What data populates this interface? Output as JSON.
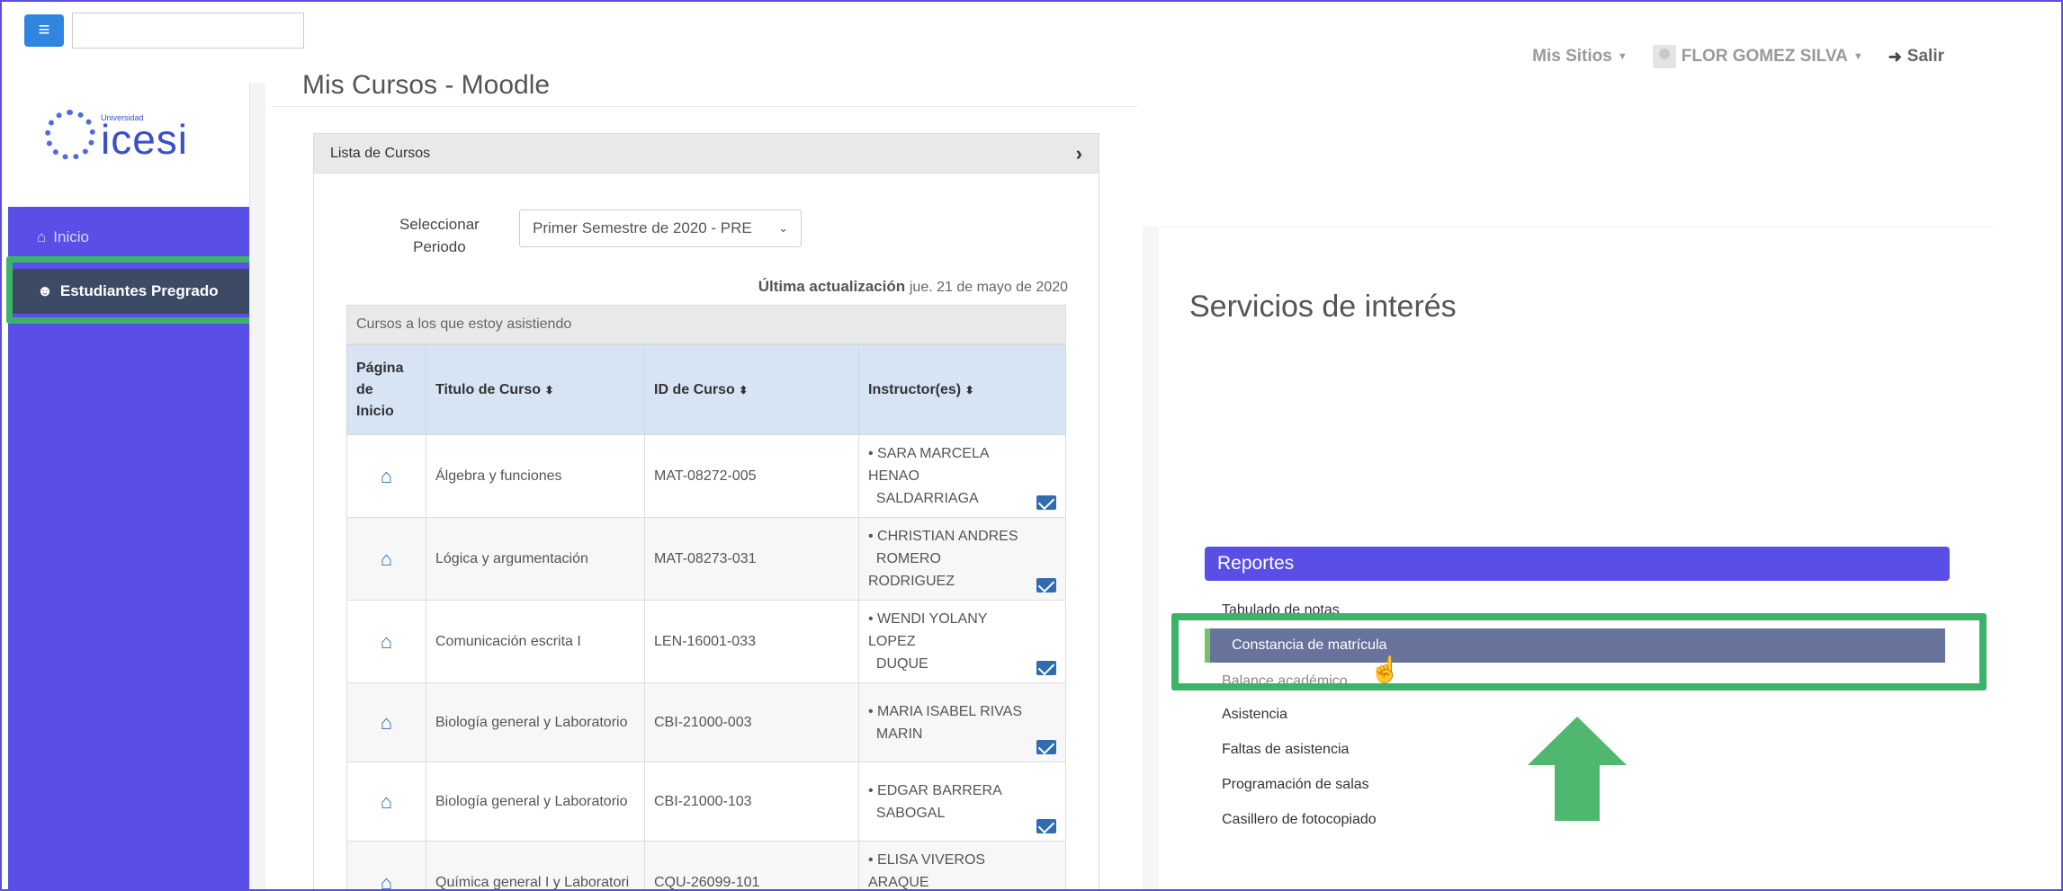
{
  "topbar": {
    "menu_icon": "hamburger-icon",
    "search_value": "",
    "sites_label": "Mis Sitios",
    "user_name": "FLOR GOMEZ SILVA",
    "logout_label": "Salir"
  },
  "logo": {
    "small": "Universidad",
    "big": "icesi"
  },
  "sidebar": {
    "items": [
      {
        "label": "Inicio",
        "icon": "home-icon"
      },
      {
        "label": "Estudiantes Pregrado",
        "icon": "student-icon"
      }
    ]
  },
  "main": {
    "title": "Mis Cursos - Moodle",
    "panel_title": "Lista de Cursos",
    "period_label_1": "Seleccionar",
    "period_label_2": "Periodo",
    "period_value": "Primer Semestre de 2020 - PRE",
    "updated_label": "Última actualización",
    "updated_value": "jue. 21 de mayo de 2020",
    "table_caption": "Cursos a los que estoy asistiendo",
    "columns": [
      "Página de Inicio",
      "Titulo de Curso",
      "ID de Curso",
      "Instructor(es)"
    ],
    "column_home_lines": [
      "Página",
      "de",
      "Inicio"
    ],
    "rows": [
      {
        "title": "Álgebra y funciones",
        "id": "MAT-08272-005",
        "instructor_1": "SARA MARCELA HENAO",
        "instructor_2": "SALDARRIAGA"
      },
      {
        "title": "Lógica y argumentación",
        "id": "MAT-08273-031",
        "instructor_1": "CHRISTIAN ANDRES",
        "instructor_2": "ROMERO RODRIGUEZ"
      },
      {
        "title": "Comunicación escrita I",
        "id": "LEN-16001-033",
        "instructor_1": "WENDI YOLANY LOPEZ",
        "instructor_2": "DUQUE"
      },
      {
        "title": "Biología general y Laboratorio",
        "id": "CBI-21000-003",
        "instructor_1": "MARIA ISABEL RIVAS",
        "instructor_2": "MARIN"
      },
      {
        "title": "Biología general y Laboratorio",
        "id": "CBI-21000-103",
        "instructor_1": "EDGAR BARRERA",
        "instructor_2": "SABOGAL"
      },
      {
        "title": "Química general I y Laboratori",
        "id": "CQU-26099-101",
        "instructor_1": "ELISA VIVEROS ARAQUE",
        "instructor_2": ""
      }
    ]
  },
  "services": {
    "title": "Servicios de interés",
    "reports_header": "Reportes",
    "items": [
      "Tabulado de notas",
      "Constancia de matrícula",
      "Balance académico",
      "Asistencia",
      "Faltas de asistencia",
      "Programación de salas",
      "Casillero de fotocopiado"
    ]
  },
  "colors": {
    "accent": "#594fe6",
    "highlight": "#3bb46a",
    "link": "#2f6db0"
  }
}
